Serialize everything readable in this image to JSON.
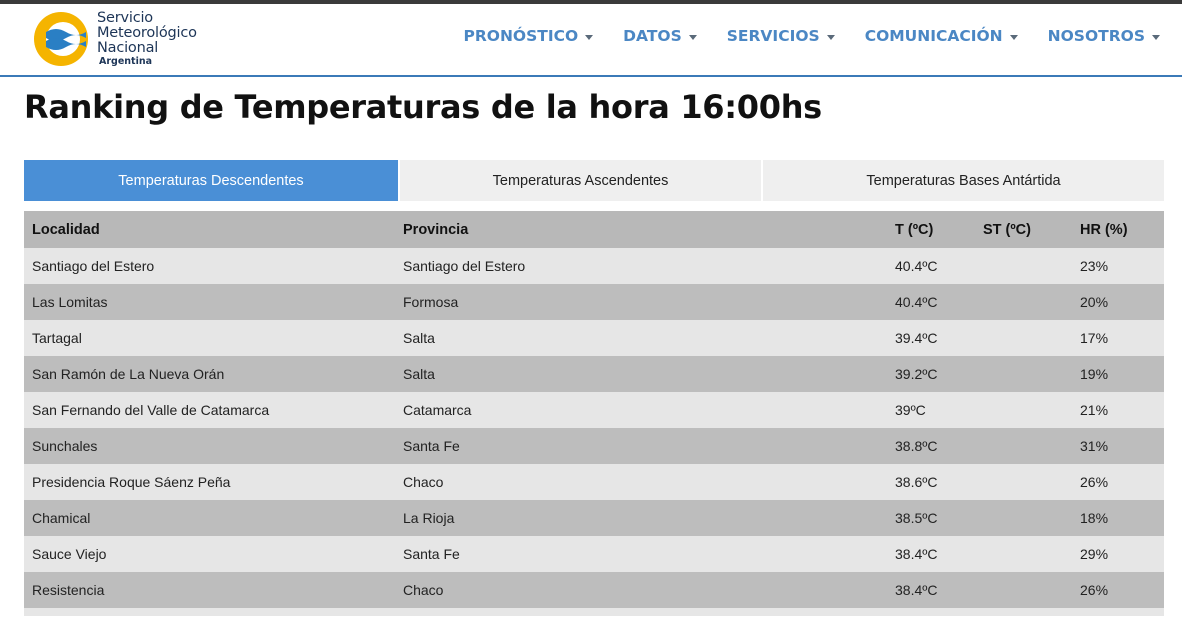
{
  "colors": {
    "brand_blue": "#4b87c4",
    "active_tab": "#4a8fd6",
    "header_rule": "#3b7ab8",
    "row_light": "#e6e6e6",
    "row_dark": "#bdbdbd"
  },
  "logo": {
    "line1": "Servicio",
    "line2": "Meteorológico",
    "line3": "Nacional",
    "sub": "Argentina",
    "icon": "smn-logo-icon"
  },
  "nav": [
    {
      "label": "PRONÓSTICO",
      "icon": "caret-down-icon"
    },
    {
      "label": "DATOS",
      "icon": "caret-down-icon"
    },
    {
      "label": "SERVICIOS",
      "icon": "caret-down-icon"
    },
    {
      "label": "COMUNICACIÓN",
      "icon": "caret-down-icon"
    },
    {
      "label": "NOSOTROS",
      "icon": "caret-down-icon"
    }
  ],
  "page_title": "Ranking de Temperaturas de la hora 16:00hs",
  "tabs": [
    {
      "label": "Temperaturas Descendentes",
      "active": true
    },
    {
      "label": "Temperaturas Ascendentes",
      "active": false
    },
    {
      "label": "Temperaturas Bases Antártida",
      "active": false
    }
  ],
  "table": {
    "headers": [
      "Localidad",
      "Provincia",
      "T (ºC)",
      "ST (ºC)",
      "HR (%)"
    ],
    "rows": [
      {
        "localidad": "Santiago del Estero",
        "provincia": "Santiago del Estero",
        "t": "40.4ºC",
        "st": "",
        "hr": "23%"
      },
      {
        "localidad": "Las Lomitas",
        "provincia": "Formosa",
        "t": "40.4ºC",
        "st": "",
        "hr": "20%"
      },
      {
        "localidad": "Tartagal",
        "provincia": "Salta",
        "t": "39.4ºC",
        "st": "",
        "hr": "17%"
      },
      {
        "localidad": "San Ramón de La Nueva Orán",
        "provincia": "Salta",
        "t": "39.2ºC",
        "st": "",
        "hr": "19%"
      },
      {
        "localidad": "San Fernando del Valle de Catamarca",
        "provincia": "Catamarca",
        "t": "39ºC",
        "st": "",
        "hr": "21%"
      },
      {
        "localidad": "Sunchales",
        "provincia": "Santa Fe",
        "t": "38.8ºC",
        "st": "",
        "hr": "31%"
      },
      {
        "localidad": "Presidencia Roque Sáenz Peña",
        "provincia": "Chaco",
        "t": "38.6ºC",
        "st": "",
        "hr": "26%"
      },
      {
        "localidad": "Chamical",
        "provincia": "La Rioja",
        "t": "38.5ºC",
        "st": "",
        "hr": "18%"
      },
      {
        "localidad": "Sauce Viejo",
        "provincia": "Santa Fe",
        "t": "38.4ºC",
        "st": "",
        "hr": "29%"
      },
      {
        "localidad": "Resistencia",
        "provincia": "Chaco",
        "t": "38.4ºC",
        "st": "",
        "hr": "26%"
      }
    ]
  }
}
